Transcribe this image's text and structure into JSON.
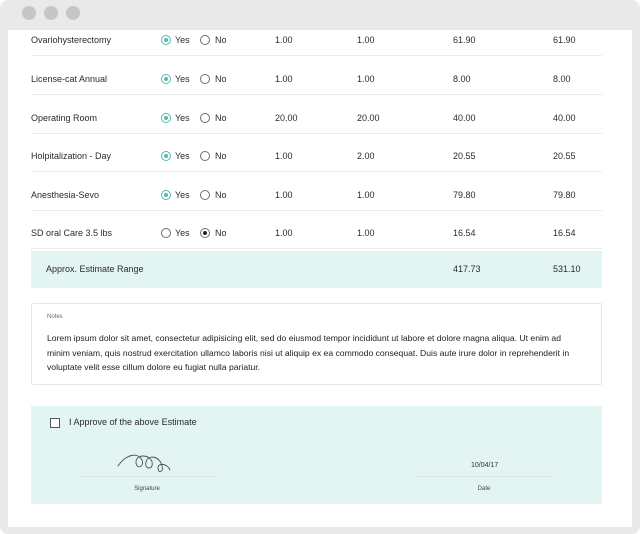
{
  "window": {
    "controls": [
      "close",
      "minimize",
      "maximize"
    ]
  },
  "estimate": {
    "radio_yes_label": "Yes",
    "radio_no_label": "No",
    "rows": [
      {
        "name": "Ovariohysterectomy",
        "selected": "yes",
        "qty_low": "1.00",
        "qty_high": "1.00",
        "price_low": "61.90",
        "price_high": "61.90"
      },
      {
        "name": "License-cat Annual",
        "selected": "yes",
        "qty_low": "1.00",
        "qty_high": "1.00",
        "price_low": "8.00",
        "price_high": "8.00"
      },
      {
        "name": "Operating Room",
        "selected": "yes",
        "qty_low": "20.00",
        "qty_high": "20.00",
        "price_low": "40.00",
        "price_high": "40.00"
      },
      {
        "name": "Holpitalization - Day",
        "selected": "yes",
        "qty_low": "1.00",
        "qty_high": "2.00",
        "price_low": "20.55",
        "price_high": "20.55"
      },
      {
        "name": "Anesthesia-Sevo",
        "selected": "yes",
        "qty_low": "1.00",
        "qty_high": "1.00",
        "price_low": "79.80",
        "price_high": "79.80"
      },
      {
        "name": "SD oral Care 3.5 lbs",
        "selected": "no",
        "qty_low": "1.00",
        "qty_high": "1.00",
        "price_low": "16.54",
        "price_high": "16.54"
      }
    ],
    "range": {
      "label": "Approx. Estimate Range",
      "low": "417.73",
      "high": "531.10"
    }
  },
  "notes": {
    "label": "Notes",
    "text": "Lorem ipsum dolor sit amet, consectetur adipisicing elit, sed do eiusmod tempor incididunt ut labore et dolore magna aliqua. Ut enim ad minim veniam, quis nostrud exercitation ullamco laboris nisi ut aliquip ex ea commodo consequat. Duis aute irure dolor in reprehenderit in voluptate velit esse cillum dolore eu fugiat nulla pariatur."
  },
  "approval": {
    "checkbox_label": "I Approve of the above Estimate",
    "checked": false,
    "signature_caption": "Signature",
    "date_caption": "Date",
    "date_value": "10/04/17"
  },
  "colors": {
    "accent": "#56b8b0",
    "panel_bg": "#e2f5f3",
    "frame_bg": "#e9e9e9"
  }
}
